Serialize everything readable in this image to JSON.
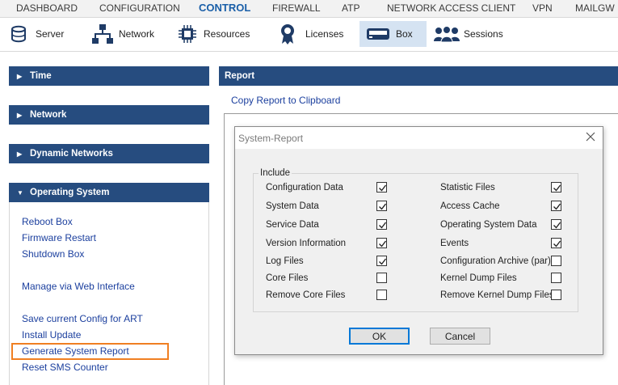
{
  "topnav": {
    "items": [
      "DASHBOARD",
      "CONFIGURATION",
      "CONTROL",
      "FIREWALL",
      "ATP",
      "NETWORK ACCESS CLIENT",
      "VPN",
      "MAILGW"
    ],
    "active": "CONTROL"
  },
  "subnav": {
    "items": [
      {
        "label": "Server",
        "icon": "server-icon"
      },
      {
        "label": "Network",
        "icon": "network-icon"
      },
      {
        "label": "Resources",
        "icon": "resources-icon"
      },
      {
        "label": "Licenses",
        "icon": "licenses-icon"
      },
      {
        "label": "Box",
        "icon": "box-icon"
      },
      {
        "label": "Sessions",
        "icon": "sessions-icon"
      }
    ],
    "active": "Box"
  },
  "left": {
    "sections": [
      {
        "label": "Time",
        "expanded": false
      },
      {
        "label": "Network",
        "expanded": false
      },
      {
        "label": "Dynamic Networks",
        "expanded": false
      },
      {
        "label": "Operating System",
        "expanded": true
      }
    ],
    "os_links": [
      "Reboot Box",
      "Firmware Restart",
      "Shutdown Box",
      "Manage via Web Interface",
      "Save current Config for ART",
      "Install Update",
      "Generate System Report",
      "Reset SMS Counter"
    ],
    "highlighted_link": "Generate System Report"
  },
  "report": {
    "header": "Report",
    "copy_link": "Copy Report to Clipboard"
  },
  "dialog": {
    "title": "System-Report",
    "group_label": "Include",
    "left_options": [
      {
        "label": "Configuration Data",
        "checked": true
      },
      {
        "label": "System Data",
        "checked": true
      },
      {
        "label": "Service Data",
        "checked": true
      },
      {
        "label": "Version Information",
        "checked": true
      },
      {
        "label": "Log Files",
        "checked": true
      },
      {
        "label": "Core Files",
        "checked": false
      },
      {
        "label": "Remove Core Files",
        "checked": false
      }
    ],
    "right_options": [
      {
        "label": "Statistic Files",
        "checked": true
      },
      {
        "label": "Access Cache",
        "checked": true
      },
      {
        "label": "Operating System Data",
        "checked": true
      },
      {
        "label": "Events",
        "checked": true
      },
      {
        "label": "Configuration Archive (par)",
        "checked": false
      },
      {
        "label": "Kernel Dump Files",
        "checked": false
      },
      {
        "label": "Remove Kernel Dump Files",
        "checked": false
      }
    ],
    "ok_label": "OK",
    "cancel_label": "Cancel"
  },
  "colors": {
    "panel_header": "#264c7f",
    "active_nav": "#1a5fa8",
    "link": "#1b3f9e",
    "highlight": "#f07f22",
    "active_tab_bg": "#d5e3f2"
  }
}
